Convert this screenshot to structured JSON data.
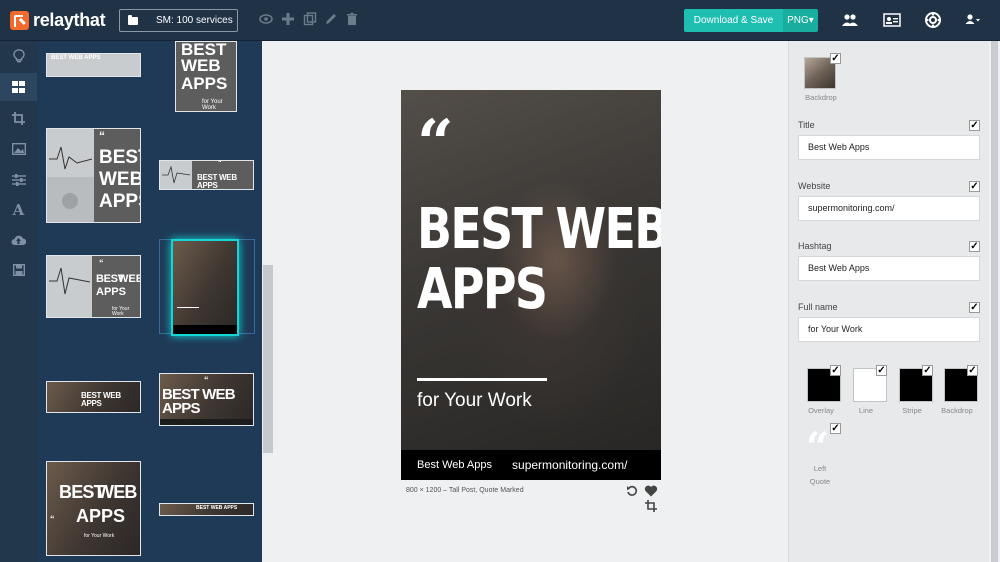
{
  "app": {
    "brand": "relaythat"
  },
  "toolbar": {
    "project_label": "SM: 100 services",
    "download_label": "Download & Save",
    "format_label": "PNG▾",
    "icons": [
      "eye-icon",
      "plus-icon",
      "duplicate-icon",
      "pencil-icon",
      "trash-icon"
    ],
    "right_icons": [
      "team-icon",
      "profile-card-icon",
      "help-icon",
      "user-menu-icon"
    ]
  },
  "rail": {
    "items": [
      "idea-icon",
      "layouts-icon",
      "crop-icon",
      "image-icon",
      "adjust-icon",
      "text-icon",
      "upload-icon",
      "save-icon"
    ],
    "active": "layouts-icon"
  },
  "thumbnails": {
    "title_word1": "BEST",
    "title_word2": "WEB",
    "title_word3": "APPS",
    "title_full": "BEST WEB APPS",
    "subtitle": "for Your Work",
    "quote": "“"
  },
  "canvas": {
    "quote_mark": "“",
    "title_line1": "BEST WEB",
    "title_line2": "APPS",
    "fullname": "for Your Work",
    "hashtag": "Best Web Apps",
    "website": "supermonitoring.com/",
    "caption": "800 × 1200 – Tall Post, Quote Marked"
  },
  "panel": {
    "backdrop_label": "Backdrop",
    "fields": [
      {
        "label": "Title",
        "value": "Best Web Apps",
        "checked": true
      },
      {
        "label": "Website",
        "value": "supermonitoring.com/",
        "checked": true
      },
      {
        "label": "Hashtag",
        "value": "Best Web Apps",
        "checked": true
      },
      {
        "label": "Full name",
        "value": "for Your Work",
        "checked": true
      }
    ],
    "swatches": [
      {
        "label": "Overlay",
        "color": "#000000"
      },
      {
        "label": "Line",
        "color": "#ffffff"
      },
      {
        "label": "Stripe",
        "color": "#000000"
      },
      {
        "label": "Backdrop",
        "color": "#000000"
      }
    ],
    "quote_style_line1": "Left",
    "quote_style_line2": "Quote"
  },
  "colors": {
    "accent": "#1ebfb1",
    "brand": "#f26a2e",
    "nav": "#1f3246"
  }
}
